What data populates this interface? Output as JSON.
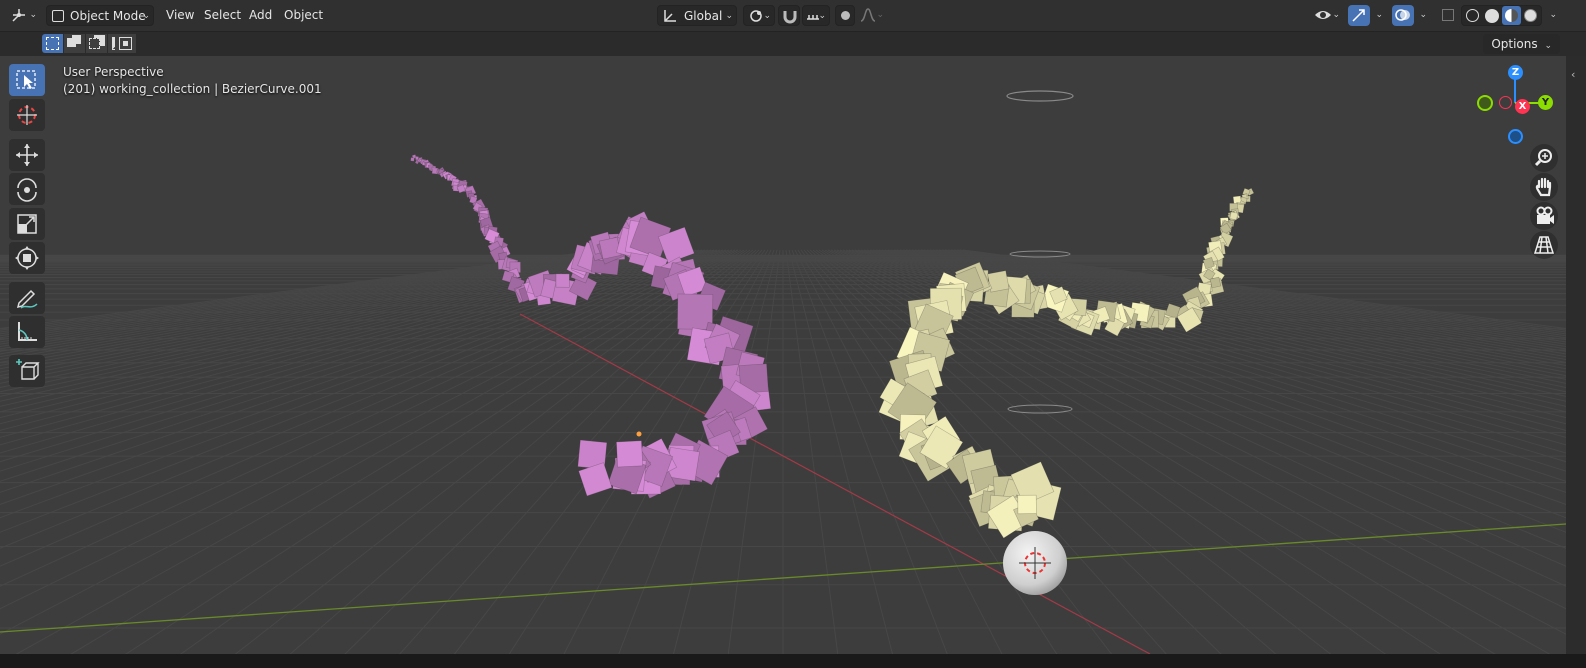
{
  "header": {
    "mode": "Object Mode",
    "menus": [
      "View",
      "Select",
      "Add",
      "Object"
    ],
    "orientation": "Global"
  },
  "row2": {
    "options": "Options"
  },
  "viewport": {
    "view_name": "User Perspective",
    "object_info": "(201) working_collection | BezierCurve.001"
  },
  "gizmo": {
    "z": "Z",
    "x": "X",
    "y": "Y"
  },
  "colors": {
    "accent": "#4772b3",
    "x_axis": "#ff3352",
    "y_axis": "#8bdc00",
    "z_axis": "#2b8fff",
    "magenta_object": "#c787c7",
    "yellow_object": "#e6e2ae"
  },
  "icons": {
    "toolbar": [
      "select-box-icon",
      "cursor-icon",
      "move-icon",
      "rotate-icon",
      "scale-icon",
      "transform-icon",
      "annotate-icon",
      "measure-icon",
      "add-cube-icon"
    ],
    "nav": [
      "zoom-icon",
      "hand-icon",
      "camera-icon",
      "grid-icon"
    ]
  }
}
